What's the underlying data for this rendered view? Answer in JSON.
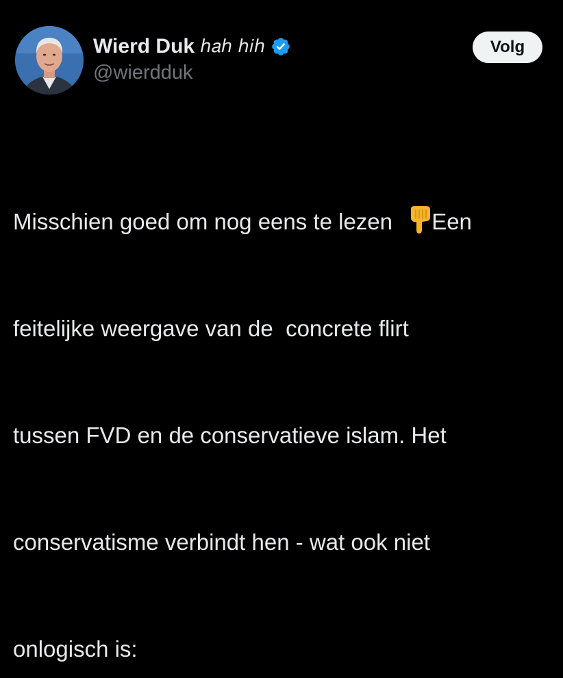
{
  "author": {
    "display_name": "Wierd Duk",
    "name_suffix": "ℎ𝑎ℎ ℎ𝑖ℎ",
    "handle": "@wierdduk",
    "verified_badge": "verified-badge-icon",
    "avatar": "avatar-photo"
  },
  "actions": {
    "follow_label": "Volg"
  },
  "tweet": {
    "line1_a": "Misschien goed om nog eens te lezen ",
    "line1_emoji": "backhand-index-pointing-down-emoji",
    "line1_b": "Een",
    "line2": "feitelijke weergave van de  concrete flirt",
    "line3": "tussen FVD en de conservatieve islam. Het",
    "line4": "conservatisme verbindt hen - wat ook niet",
    "line5": "onlogisch is:"
  },
  "colors": {
    "background": "#000000",
    "text_primary": "#e7e9ea",
    "text_secondary": "#71767b",
    "verified": "#1d9bf0",
    "follow_bg": "#eff3f4",
    "follow_text": "#0f1419"
  }
}
